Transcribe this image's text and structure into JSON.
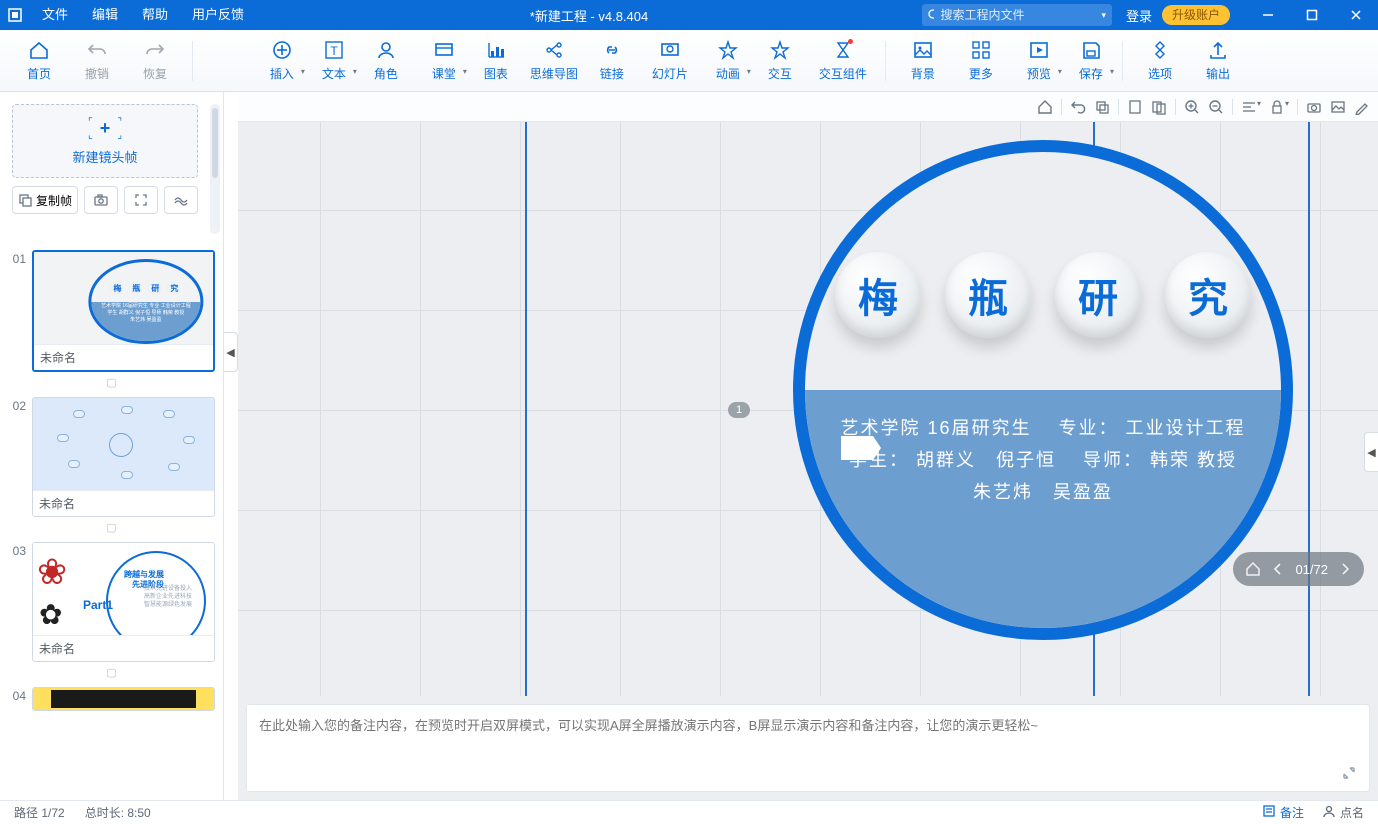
{
  "menu": {
    "file": "文件",
    "edit": "编辑",
    "help": "帮助",
    "feedback": "用户反馈"
  },
  "title": "*新建工程 - v4.8.404",
  "search": {
    "placeholder": "搜索工程内文件"
  },
  "login": "登录",
  "upgrade": "升级账户",
  "ribbon": {
    "home": "首页",
    "undo": "撤销",
    "redo": "恢复",
    "insert": "插入",
    "text": "文本",
    "role": "角色",
    "class": "课堂",
    "chart": "图表",
    "mindmap": "思维导图",
    "link": "链接",
    "slide": "幻灯片",
    "anim": "动画",
    "interact": "交互",
    "component": "交互组件",
    "bg": "背景",
    "more": "更多",
    "preview": "预览",
    "save": "保存",
    "options": "选项",
    "output": "输出"
  },
  "sidebar": {
    "newframe": "新建镜头帧",
    "copyframe": "复制帧",
    "slides": [
      {
        "num": "01",
        "caption": "未命名"
      },
      {
        "num": "02",
        "caption": "未命名"
      },
      {
        "num": "03",
        "caption": "未命名"
      },
      {
        "num": "04",
        "caption": ""
      }
    ],
    "timer": "⏱"
  },
  "content": {
    "chars": {
      "c1": "梅",
      "c2": "瓶",
      "c3": "研",
      "c4": "究"
    },
    "line1": "艺术学院 16届研究生　 专业： 工业设计工程",
    "line2": "学生： 胡群义　倪子恒　 导师： 韩荣 教授",
    "line3": "朱艺炜　吴盈盈",
    "pagemarker": "1",
    "s3": {
      "title": "跨越与发展",
      "sub": "先进阶段",
      "part": "Part1"
    }
  },
  "notes": {
    "placeholder": "在此处输入您的备注内容，在预览时开启双屏模式，可以实现A屏全屏播放演示内容，B屏显示演示内容和备注内容，让您的演示更轻松~"
  },
  "navpill": "01/72",
  "status": {
    "path": "路径 1/72",
    "duration": "总时长: 8:50",
    "notes": "备注",
    "dm": "点名"
  }
}
